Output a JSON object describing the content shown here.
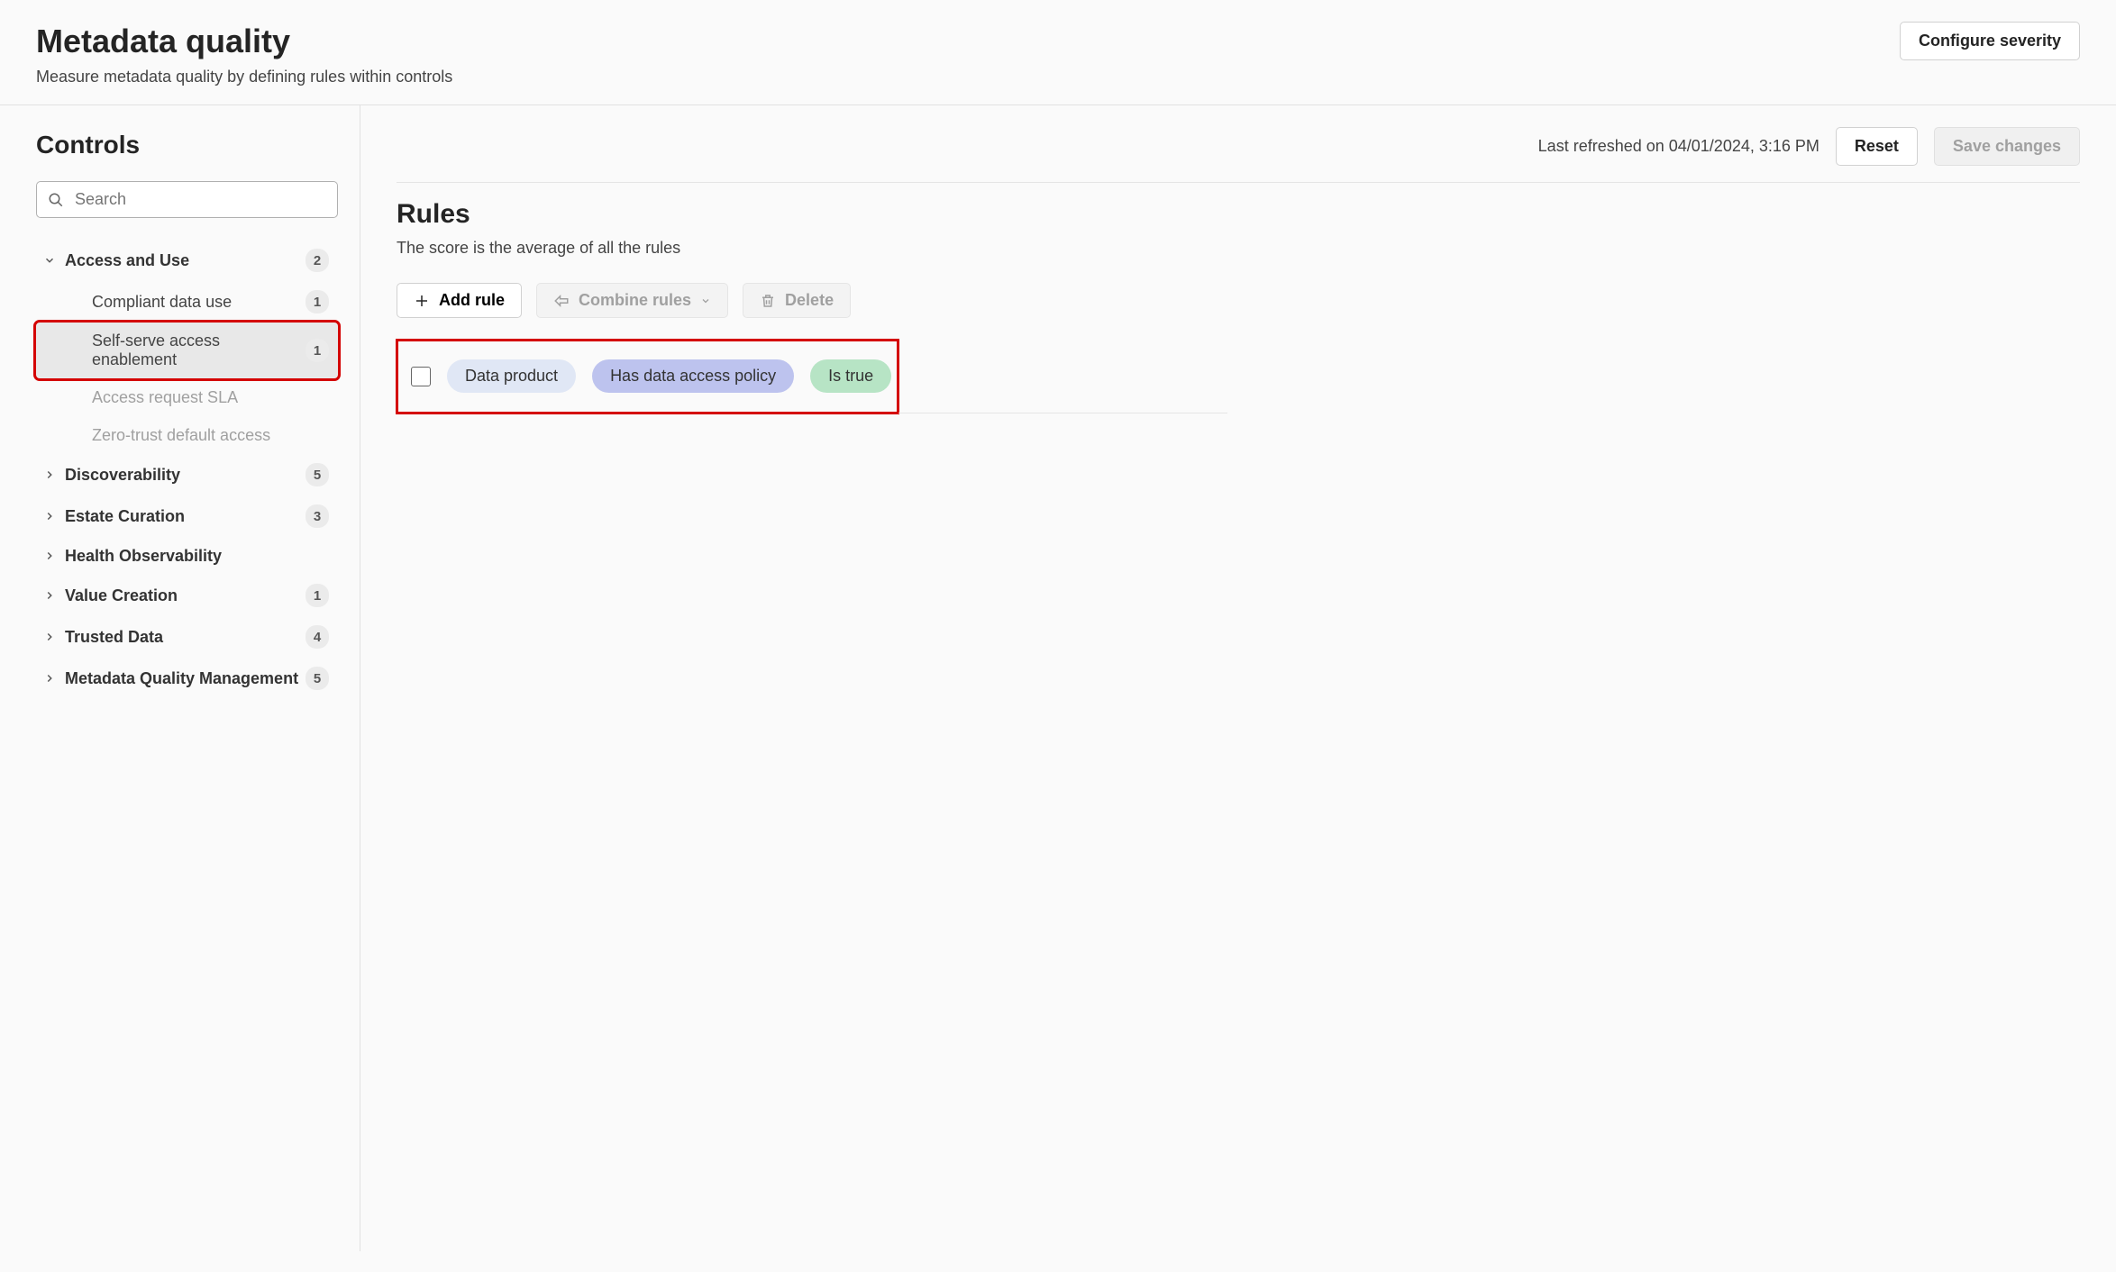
{
  "header": {
    "title": "Metadata quality",
    "subtitle": "Measure metadata quality by defining rules within controls",
    "configure_button": "Configure severity"
  },
  "sidebar": {
    "title": "Controls",
    "search_placeholder": "Search",
    "groups": [
      {
        "label": "Access and Use",
        "badge": "2",
        "expanded": true,
        "children": [
          {
            "label": "Compliant data use",
            "badge": "1",
            "selected": false,
            "disabled": false
          },
          {
            "label": "Self-serve access enablement",
            "badge": "1",
            "selected": true,
            "disabled": false
          },
          {
            "label": "Access request SLA",
            "badge": "",
            "selected": false,
            "disabled": true
          },
          {
            "label": "Zero-trust default access",
            "badge": "",
            "selected": false,
            "disabled": true
          }
        ]
      },
      {
        "label": "Discoverability",
        "badge": "5",
        "expanded": false
      },
      {
        "label": "Estate Curation",
        "badge": "3",
        "expanded": false
      },
      {
        "label": "Health Observability",
        "badge": "",
        "expanded": false
      },
      {
        "label": "Value Creation",
        "badge": "1",
        "expanded": false
      },
      {
        "label": "Trusted Data",
        "badge": "4",
        "expanded": false
      },
      {
        "label": "Metadata Quality Management",
        "badge": "5",
        "expanded": false
      }
    ]
  },
  "content": {
    "refresh_text": "Last refreshed on 04/01/2024, 3:16 PM",
    "reset_button": "Reset",
    "save_button": "Save changes",
    "rules_title": "Rules",
    "rules_subtitle": "The score is the average of all the rules",
    "toolbar": {
      "add_rule": "Add rule",
      "combine_rules": "Combine rules",
      "delete": "Delete"
    },
    "rules": [
      {
        "subject": "Data product",
        "condition": "Has data access policy",
        "value": "Is true"
      }
    ]
  }
}
